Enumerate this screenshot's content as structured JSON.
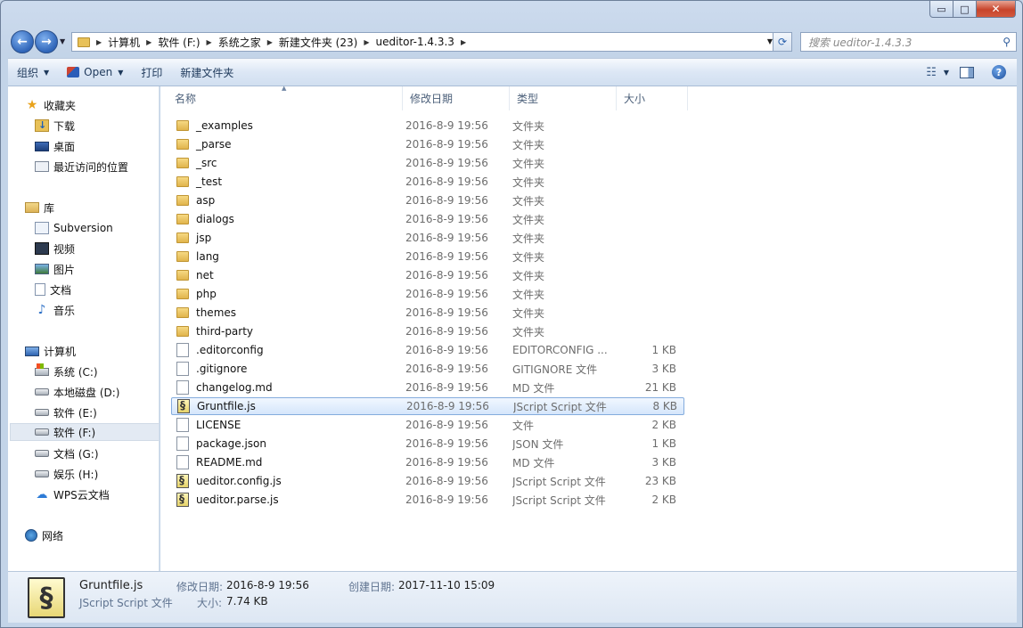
{
  "caption": {
    "minimize": "▭",
    "maximize": "□",
    "close": "✕"
  },
  "address": {
    "crumbs": [
      "计算机",
      "软件 (F:)",
      "系统之家",
      "新建文件夹 (23)",
      "ueditor-1.4.3.3"
    ]
  },
  "search": {
    "placeholder": "搜索 ueditor-1.4.3.3"
  },
  "toolbar": {
    "organize": "组织",
    "open": "Open",
    "print": "打印",
    "new_folder": "新建文件夹"
  },
  "nav": {
    "favorites": "收藏夹",
    "downloads": "下载",
    "desktop": "桌面",
    "recent": "最近访问的位置",
    "libraries": "库",
    "subversion": "Subversion",
    "videos": "视频",
    "pictures": "图片",
    "documents": "文档",
    "music": "音乐",
    "computer": "计算机",
    "drive_c": "系统 (C:)",
    "drive_d": "本地磁盘 (D:)",
    "drive_e": "软件 (E:)",
    "drive_f": "软件 (F:)",
    "drive_g": "文档 (G:)",
    "drive_h": "娱乐 (H:)",
    "wps": "WPS云文档",
    "network": "网络"
  },
  "columns": {
    "name": "名称",
    "date": "修改日期",
    "type": "类型",
    "size": "大小"
  },
  "files": [
    {
      "name": "_examples",
      "date": "2016-8-9 19:56",
      "type": "文件夹",
      "size": "",
      "icon": "folder"
    },
    {
      "name": "_parse",
      "date": "2016-8-9 19:56",
      "type": "文件夹",
      "size": "",
      "icon": "folder"
    },
    {
      "name": "_src",
      "date": "2016-8-9 19:56",
      "type": "文件夹",
      "size": "",
      "icon": "folder"
    },
    {
      "name": "_test",
      "date": "2016-8-9 19:56",
      "type": "文件夹",
      "size": "",
      "icon": "folder"
    },
    {
      "name": "asp",
      "date": "2016-8-9 19:56",
      "type": "文件夹",
      "size": "",
      "icon": "folder"
    },
    {
      "name": "dialogs",
      "date": "2016-8-9 19:56",
      "type": "文件夹",
      "size": "",
      "icon": "folder"
    },
    {
      "name": "jsp",
      "date": "2016-8-9 19:56",
      "type": "文件夹",
      "size": "",
      "icon": "folder"
    },
    {
      "name": "lang",
      "date": "2016-8-9 19:56",
      "type": "文件夹",
      "size": "",
      "icon": "folder"
    },
    {
      "name": "net",
      "date": "2016-8-9 19:56",
      "type": "文件夹",
      "size": "",
      "icon": "folder"
    },
    {
      "name": "php",
      "date": "2016-8-9 19:56",
      "type": "文件夹",
      "size": "",
      "icon": "folder"
    },
    {
      "name": "themes",
      "date": "2016-8-9 19:56",
      "type": "文件夹",
      "size": "",
      "icon": "folder"
    },
    {
      "name": "third-party",
      "date": "2016-8-9 19:56",
      "type": "文件夹",
      "size": "",
      "icon": "folder"
    },
    {
      "name": ".editorconfig",
      "date": "2016-8-9 19:56",
      "type": "EDITORCONFIG ...",
      "size": "1 KB",
      "icon": "file"
    },
    {
      "name": ".gitignore",
      "date": "2016-8-9 19:56",
      "type": "GITIGNORE 文件",
      "size": "3 KB",
      "icon": "file"
    },
    {
      "name": "changelog.md",
      "date": "2016-8-9 19:56",
      "type": "MD 文件",
      "size": "21 KB",
      "icon": "file"
    },
    {
      "name": "Gruntfile.js",
      "date": "2016-8-9 19:56",
      "type": "JScript Script 文件",
      "size": "8 KB",
      "icon": "script",
      "selected": true
    },
    {
      "name": "LICENSE",
      "date": "2016-8-9 19:56",
      "type": "文件",
      "size": "2 KB",
      "icon": "file"
    },
    {
      "name": "package.json",
      "date": "2016-8-9 19:56",
      "type": "JSON 文件",
      "size": "1 KB",
      "icon": "file"
    },
    {
      "name": "README.md",
      "date": "2016-8-9 19:56",
      "type": "MD 文件",
      "size": "3 KB",
      "icon": "file"
    },
    {
      "name": "ueditor.config.js",
      "date": "2016-8-9 19:56",
      "type": "JScript Script 文件",
      "size": "23 KB",
      "icon": "script"
    },
    {
      "name": "ueditor.parse.js",
      "date": "2016-8-9 19:56",
      "type": "JScript Script 文件",
      "size": "2 KB",
      "icon": "script"
    }
  ],
  "details": {
    "name": "Gruntfile.js",
    "type": "JScript Script 文件",
    "modified_label": "修改日期:",
    "modified_value": "2016-8-9 19:56",
    "created_label": "创建日期:",
    "created_value": "2017-11-10 15:09",
    "size_label": "大小:",
    "size_value": "7.74 KB"
  }
}
